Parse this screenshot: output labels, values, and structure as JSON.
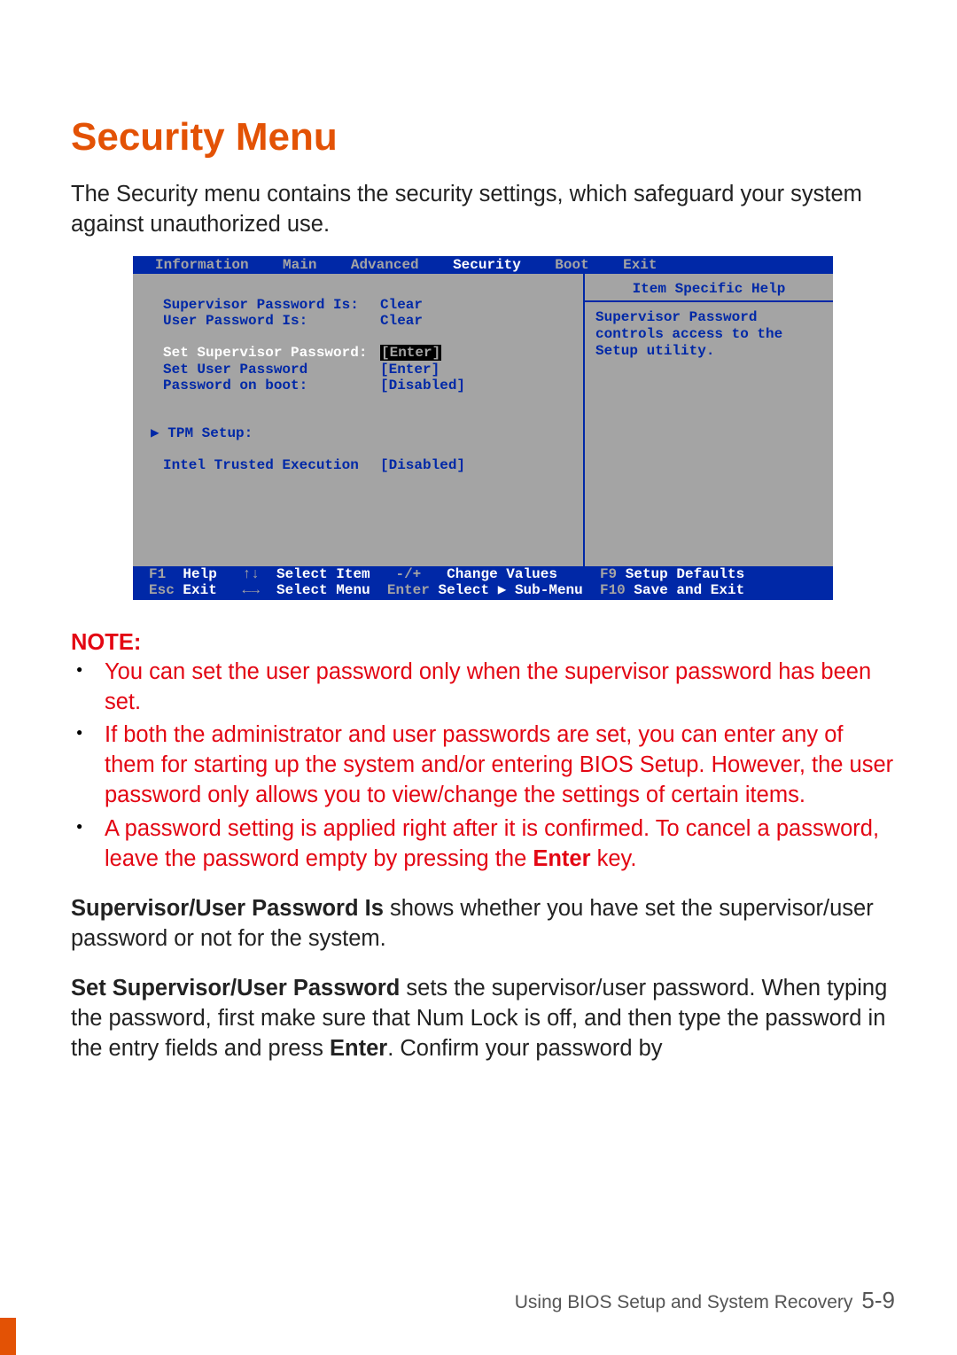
{
  "title": "Security Menu",
  "intro": "The Security menu contains the security settings, which safeguard your system against unauthorized use.",
  "bios": {
    "tabs": [
      "Information",
      "Main",
      "Advanced",
      "Security",
      "Boot",
      "Exit"
    ],
    "rows": {
      "supervisor_is_label": "Supervisor Password Is:",
      "supervisor_is_value": "Clear",
      "user_is_label": "User Password Is:",
      "user_is_value": "Clear",
      "set_supervisor_label": "Set Supervisor Password:",
      "set_supervisor_value": "[Enter]",
      "set_user_label": "Set User Password",
      "set_user_value": "[Enter]",
      "pw_on_boot_label": "Password on boot:",
      "pw_on_boot_value": "[Disabled]",
      "tpm_label": "TPM Setup:",
      "ite_label": "Intel Trusted Execution",
      "ite_value": "[Disabled]"
    },
    "help_title": "Item Specific Help",
    "help_body": "Supervisor Password controls access to the Setup utility.",
    "footer": {
      "f1": "F1",
      "help": "Help",
      "arrows_v": "↑↓",
      "select_item": "Select Item",
      "pm": "-/+",
      "change_values": "Change Values",
      "f9": "F9",
      "setup_defaults": "Setup Defaults",
      "esc": "Esc",
      "exit": "Exit",
      "arrows_h": "←→",
      "select_menu": "Select Menu",
      "enter": "Enter",
      "select_sub": "Select ▶ Sub-Menu",
      "f10": "F10",
      "save_exit": "Save and Exit"
    }
  },
  "note_heading": "NOTE:",
  "notes": [
    "You can set the user password only when the supervisor password has been set.",
    "If both the administrator and user passwords are set, you can enter any of them for starting up the system and/or entering BIOS Setup. However, the user password only allows you to view/change the settings of certain items.",
    "A password setting is applied right after it is confirmed. To cancel a password, leave the password empty by pressing the "
  ],
  "note3_key": "Enter",
  "note3_tail": " key.",
  "para1_b": "Supervisor/User Password Is",
  "para1": "  shows whether you have set the supervisor/user password or not for the system.",
  "para2_b": "Set Supervisor/User Password",
  "para2a": "  sets the supervisor/user password. When typing the password, first make sure that Num Lock is off, and then type the password in the entry fields and press ",
  "para2_key": "Enter",
  "para2b": ". Confirm your password by",
  "footer_text": "Using BIOS Setup and System Recovery",
  "page_num": "5-9"
}
